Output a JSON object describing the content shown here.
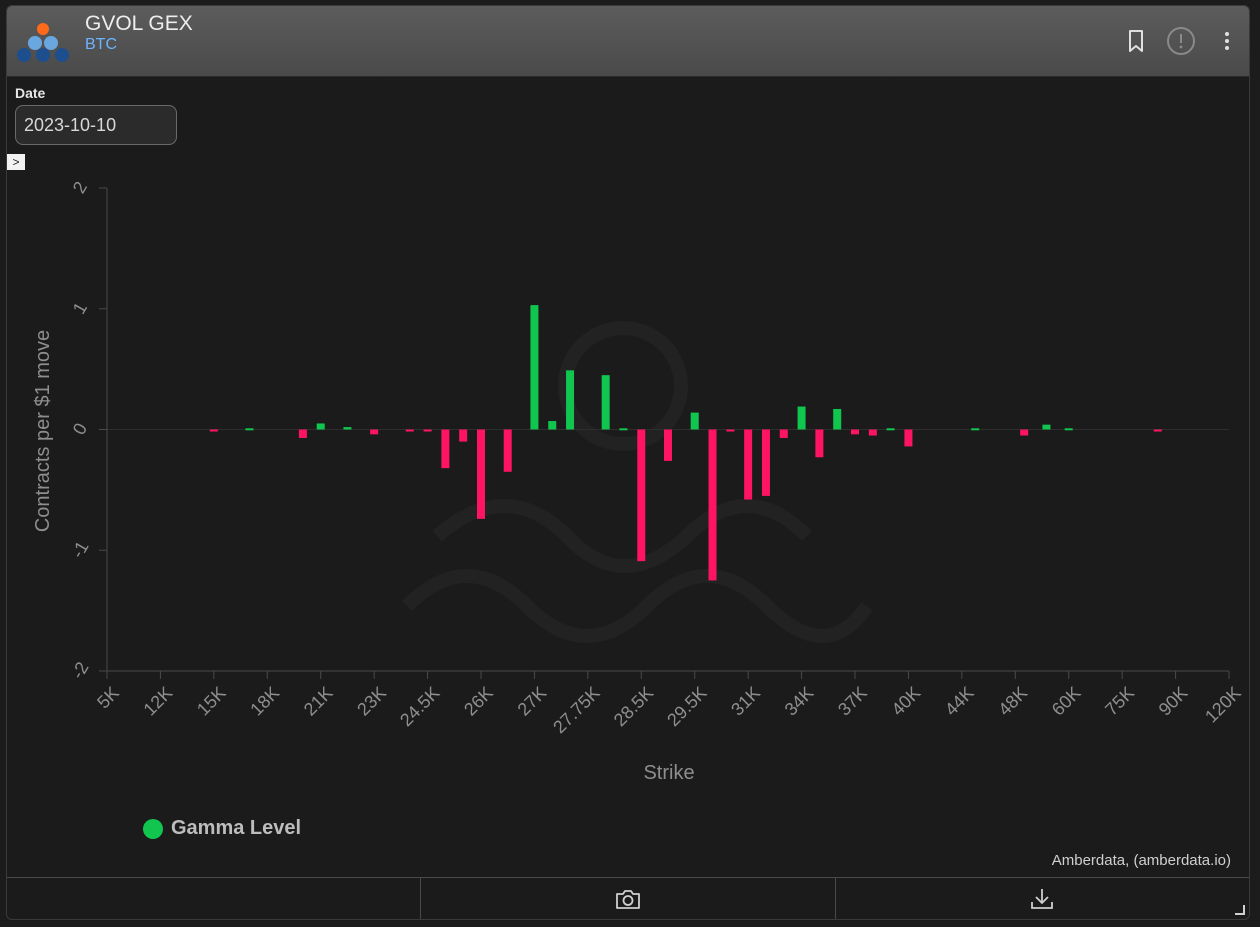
{
  "header": {
    "title": "GVOL GEX",
    "subtitle": "BTC",
    "icons": [
      "bookmark-icon",
      "info-icon",
      "more-vertical-icon"
    ]
  },
  "filters": {
    "date_label": "Date",
    "date_value": "2023-10-10"
  },
  "expander_symbol": ">",
  "legend": {
    "label": "Gamma Level",
    "color": "#11c64f"
  },
  "credit": "Amberdata, (amberdata.io)",
  "footer": {
    "icons": [
      "camera-icon",
      "download-icon"
    ]
  },
  "colors": {
    "positive": "#11c64f",
    "negative": "#ff1463",
    "background": "#1b1b1b"
  },
  "chart_data": {
    "type": "bar",
    "xlabel": "Strike",
    "ylabel": "Contracts per $1 move",
    "ylim": [
      -2,
      2
    ],
    "yticks": [
      2,
      1,
      0,
      -1,
      -2
    ],
    "xtick_labels": [
      "5K",
      "12K",
      "15K",
      "18K",
      "21K",
      "23K",
      "24.5K",
      "26K",
      "27K",
      "27.75K",
      "28.5K",
      "29.5K",
      "31K",
      "34K",
      "37K",
      "40K",
      "44K",
      "48K",
      "60K",
      "75K",
      "90K",
      "120K"
    ],
    "bars": [
      {
        "strike": "15K",
        "value": -0.01
      },
      {
        "strike": "17K",
        "value": 0.01
      },
      {
        "strike": "20K",
        "value": -0.07
      },
      {
        "strike": "21K",
        "value": 0.05
      },
      {
        "strike": "22K",
        "value": 0.02
      },
      {
        "strike": "23K",
        "value": -0.04
      },
      {
        "strike": "24K",
        "value": -0.01
      },
      {
        "strike": "24.5K",
        "value": -0.01
      },
      {
        "strike": "25K",
        "value": -0.32
      },
      {
        "strike": "25.5K",
        "value": -0.1
      },
      {
        "strike": "26K",
        "value": -0.74
      },
      {
        "strike": "26.5K",
        "value": -0.35
      },
      {
        "strike": "27K",
        "value": 1.03
      },
      {
        "strike": "27.25K",
        "value": 0.07
      },
      {
        "strike": "27.5K",
        "value": 0.49
      },
      {
        "strike": "28K",
        "value": 0.45
      },
      {
        "strike": "28.25K",
        "value": 0.01
      },
      {
        "strike": "28.5K",
        "value": -1.09
      },
      {
        "strike": "29K",
        "value": -0.26
      },
      {
        "strike": "29.5K",
        "value": 0.14
      },
      {
        "strike": "30K",
        "value": -1.25
      },
      {
        "strike": "30.5K",
        "value": -0.01
      },
      {
        "strike": "31K",
        "value": -0.58
      },
      {
        "strike": "32K",
        "value": -0.55
      },
      {
        "strike": "33K",
        "value": -0.07
      },
      {
        "strike": "34K",
        "value": 0.19
      },
      {
        "strike": "35K",
        "value": -0.23
      },
      {
        "strike": "36K",
        "value": 0.17
      },
      {
        "strike": "37K",
        "value": -0.04
      },
      {
        "strike": "38K",
        "value": -0.05
      },
      {
        "strike": "39K",
        "value": 0.01
      },
      {
        "strike": "40K",
        "value": -0.14
      },
      {
        "strike": "45K",
        "value": 0.01
      },
      {
        "strike": "50K",
        "value": -0.05
      },
      {
        "strike": "55K",
        "value": 0.04
      },
      {
        "strike": "60K",
        "value": 0.01
      },
      {
        "strike": "85K",
        "value": -0.01
      }
    ]
  }
}
